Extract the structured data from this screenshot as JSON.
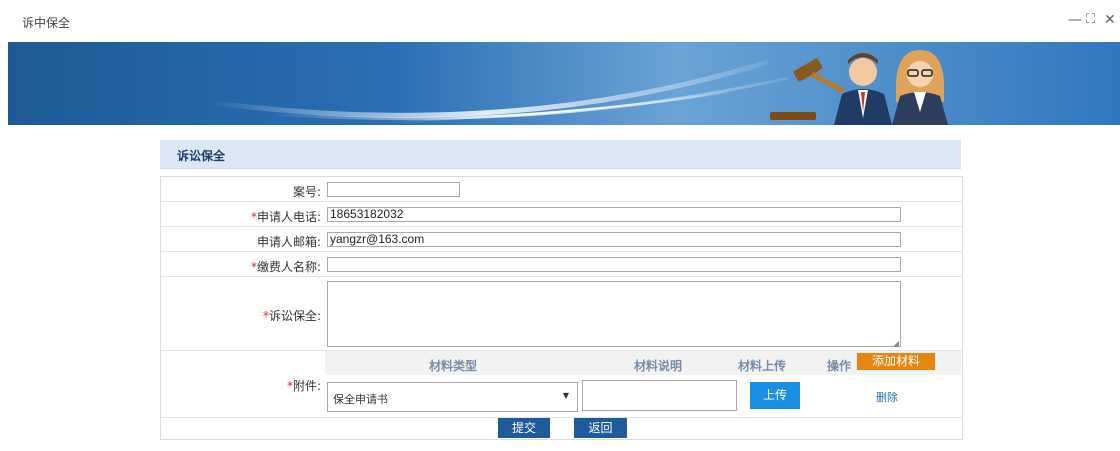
{
  "window": {
    "title": "诉中保全",
    "minimize": "—",
    "maximize": "⛶",
    "close": "✕"
  },
  "panel": {
    "title": "诉讼保全"
  },
  "form": {
    "case_no": {
      "label": "案号:",
      "value": ""
    },
    "phone": {
      "required": "*",
      "label": "申请人电话:",
      "value": "18653182032"
    },
    "email": {
      "label": "申请人邮箱:",
      "value": "yangzr@163.com"
    },
    "payer": {
      "required": "*",
      "label": "缴费人名称:",
      "value": ""
    },
    "preservation": {
      "required": "*",
      "label": "诉讼保全:",
      "value": ""
    },
    "attachment": {
      "required": "*",
      "label": "附件:",
      "headers": {
        "type": "材料类型",
        "desc": "材料说明",
        "upload": "材料上传",
        "op": "操作"
      },
      "add_label": "添加材料",
      "row": {
        "type_value": "保全申请书",
        "desc_value": "",
        "upload_label": "上传",
        "delete_label": "删除"
      }
    }
  },
  "actions": {
    "submit": "提交",
    "back": "返回"
  },
  "colors": {
    "accent": "#1e6fb8",
    "orange": "#e8850f",
    "required": "#e0242d",
    "panel_bg": "#dbe7f5"
  }
}
